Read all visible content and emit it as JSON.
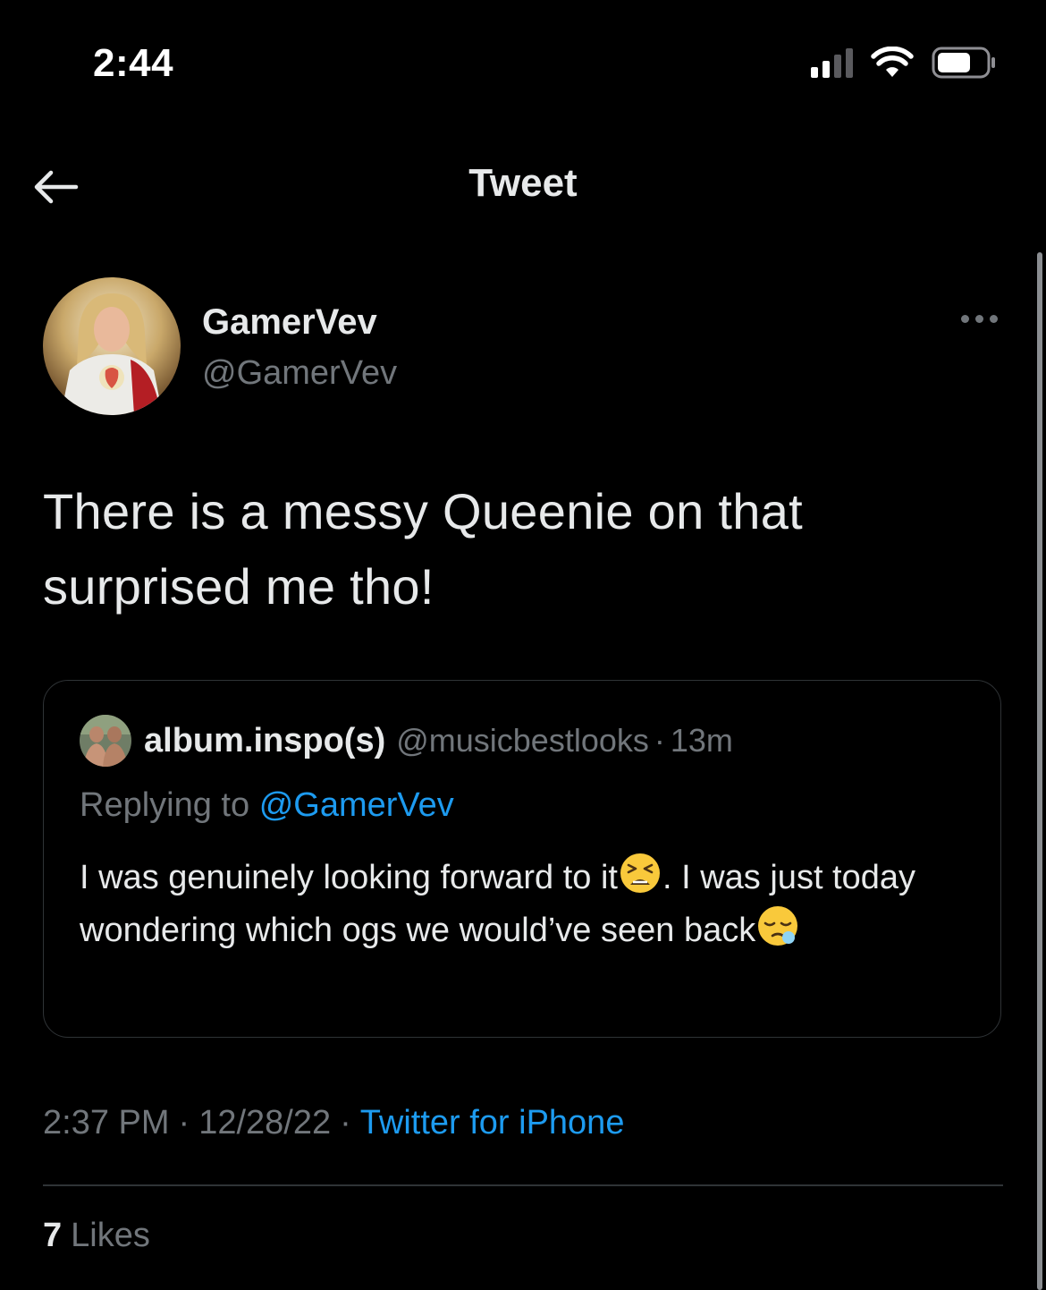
{
  "status_bar": {
    "time": "2:44",
    "signal_icon": "cellular-signal-icon",
    "wifi_icon": "wifi-icon",
    "battery_icon": "battery-icon",
    "signal_bars_active": 2,
    "signal_bars_total": 4
  },
  "nav": {
    "title": "Tweet",
    "back_icon": "back-arrow-icon"
  },
  "tweet": {
    "author_name": "GamerVev",
    "author_handle": "@GamerVev",
    "avatar_icon": "avatar-image",
    "more_icon": "more-horizontal-icon",
    "text": "There is a messy Queenie on that surprised me tho!",
    "time": "2:37 PM",
    "date": "12/28/22",
    "separator": "·",
    "source": "Twitter for iPhone",
    "likes_count": "7",
    "likes_label": "Likes"
  },
  "quote": {
    "author_name": "album.inspo(s)",
    "author_handle": "@musicbestlooks",
    "separator": "·",
    "time": "13m",
    "avatar_icon": "avatar-image",
    "replying_prefix": "Replying to",
    "replying_handle": "@GamerVev",
    "text_part1": "I was genuinely looking forward to it",
    "emoji1": "tired-face-emoji",
    "text_part2": ". I was just today wondering which ogs we would’ve seen back",
    "emoji2": "sleepy-face-emoji"
  },
  "colors": {
    "background": "#000000",
    "primary_text": "#e7e9ea",
    "secondary_text": "#71767b",
    "accent": "#1d9bf0",
    "border": "#2f3336"
  }
}
